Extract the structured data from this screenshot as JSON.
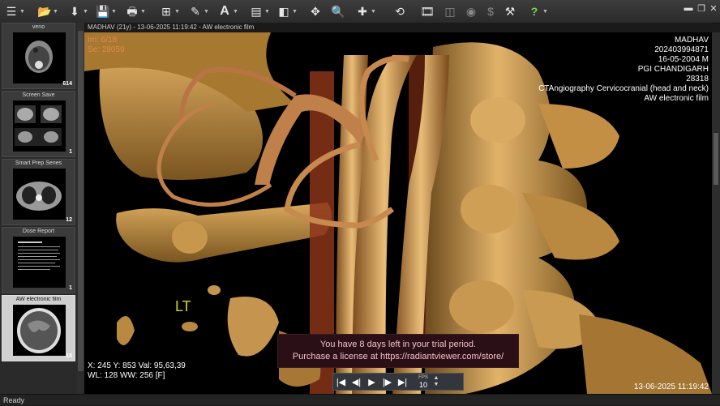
{
  "toolbar": {
    "icons": [
      {
        "name": "menu-icon",
        "glyph": "☰"
      },
      {
        "name": "open-folder-icon",
        "glyph": "📂"
      },
      {
        "name": "download-icon",
        "glyph": "⬇"
      },
      {
        "name": "save-icon",
        "glyph": "💾"
      },
      {
        "name": "print-icon",
        "glyph": "🖶"
      },
      {
        "name": "layout-grid-icon",
        "glyph": "⊞"
      },
      {
        "name": "tools-icon",
        "glyph": "✎"
      },
      {
        "name": "annotation-text-icon",
        "glyph": "A"
      },
      {
        "name": "stack-icon",
        "glyph": "▤"
      },
      {
        "name": "window-level-icon",
        "glyph": "◧"
      },
      {
        "name": "pan-icon",
        "glyph": "✥"
      },
      {
        "name": "zoom-icon",
        "glyph": "🔍"
      },
      {
        "name": "crosshair-icon",
        "glyph": "✚"
      },
      {
        "name": "reset-icon",
        "glyph": "⟲"
      },
      {
        "name": "film-icon",
        "glyph": "🎞"
      },
      {
        "name": "mpr-icon",
        "glyph": "◫"
      },
      {
        "name": "3d-icon",
        "glyph": "◉"
      },
      {
        "name": "currency-icon",
        "glyph": "$"
      },
      {
        "name": "tool-settings-icon",
        "glyph": "⚒"
      },
      {
        "name": "help-icon",
        "glyph": "?"
      }
    ],
    "minimize_glyph": "▬",
    "restore_glyph": "❐",
    "close_glyph": "✕"
  },
  "sidebar": {
    "items": [
      {
        "title": "veno",
        "count": "614"
      },
      {
        "title": "Screen Save",
        "count": "1"
      },
      {
        "title": "Smart Prep Series",
        "count": "12"
      },
      {
        "title": "Dose Report",
        "count": "1"
      },
      {
        "title": "AW electronic film",
        "count": "18"
      }
    ]
  },
  "viewer": {
    "header": "MADHAV  (21y) - 13-06-2025 11:19:42 - AW electronic film",
    "im": "Im: 6/18",
    "se": "Se: 28059",
    "patient_name": "MADHAV",
    "patient_id": "202403994871",
    "dob_sex": "16-05-2004 M",
    "institution": "PGI CHANDIGARH",
    "accession": "28318",
    "study": "CTAngiography Cervicocranial (head and neck)",
    "series": "AW electronic film",
    "lt_marker": "LT",
    "pixel_info": "X: 245 Y: 853 Val: 95,63,39",
    "window_info": "WL: 128 WW: 256 [F]",
    "datetime": "13-06-2025 11:19:42"
  },
  "trial": {
    "line1": "You have 8 days left in your trial period.",
    "line2": "Purchase a license at https://radiantviewer.com/store/"
  },
  "player": {
    "buttons": [
      {
        "name": "first-frame-button",
        "glyph": "⏮"
      },
      {
        "name": "prev-frame-button",
        "glyph": "◀"
      },
      {
        "name": "play-button",
        "glyph": "▶"
      },
      {
        "name": "next-frame-button",
        "glyph": "▶"
      },
      {
        "name": "last-frame-button",
        "glyph": "⏭"
      }
    ],
    "fps_label": "FPS",
    "fps_value": "10"
  },
  "status": "Ready"
}
